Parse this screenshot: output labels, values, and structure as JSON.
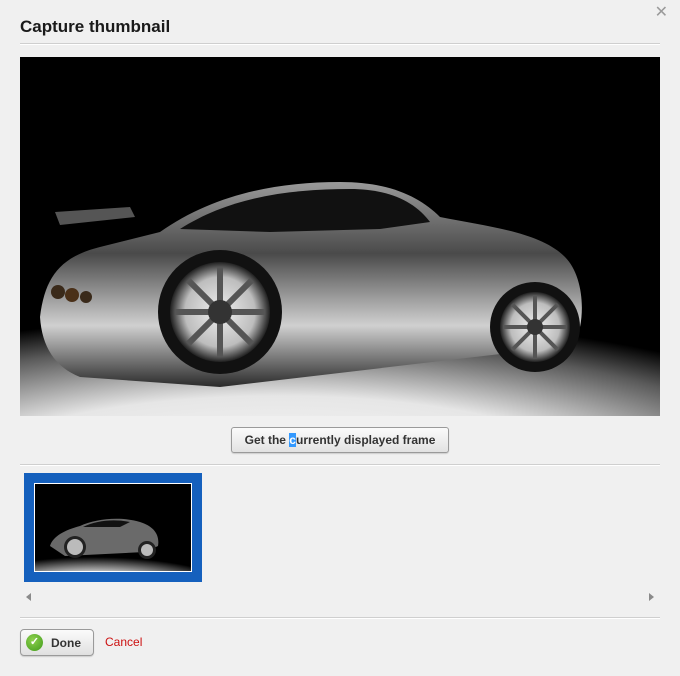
{
  "dialog": {
    "title": "Capture thumbnail",
    "close_icon": "close-icon"
  },
  "preview": {
    "image_subject": "black sports car in spotlight"
  },
  "capture_button": {
    "label_before": "Get the ",
    "label_selected": "c",
    "label_after": "urrently displayed frame"
  },
  "thumbnails": {
    "selected_index": 0,
    "accent": "#1560bd"
  },
  "footer": {
    "done_label": "Done",
    "cancel_label": "Cancel",
    "done_icon": "check-icon",
    "cancel_color": "#cc1111"
  }
}
